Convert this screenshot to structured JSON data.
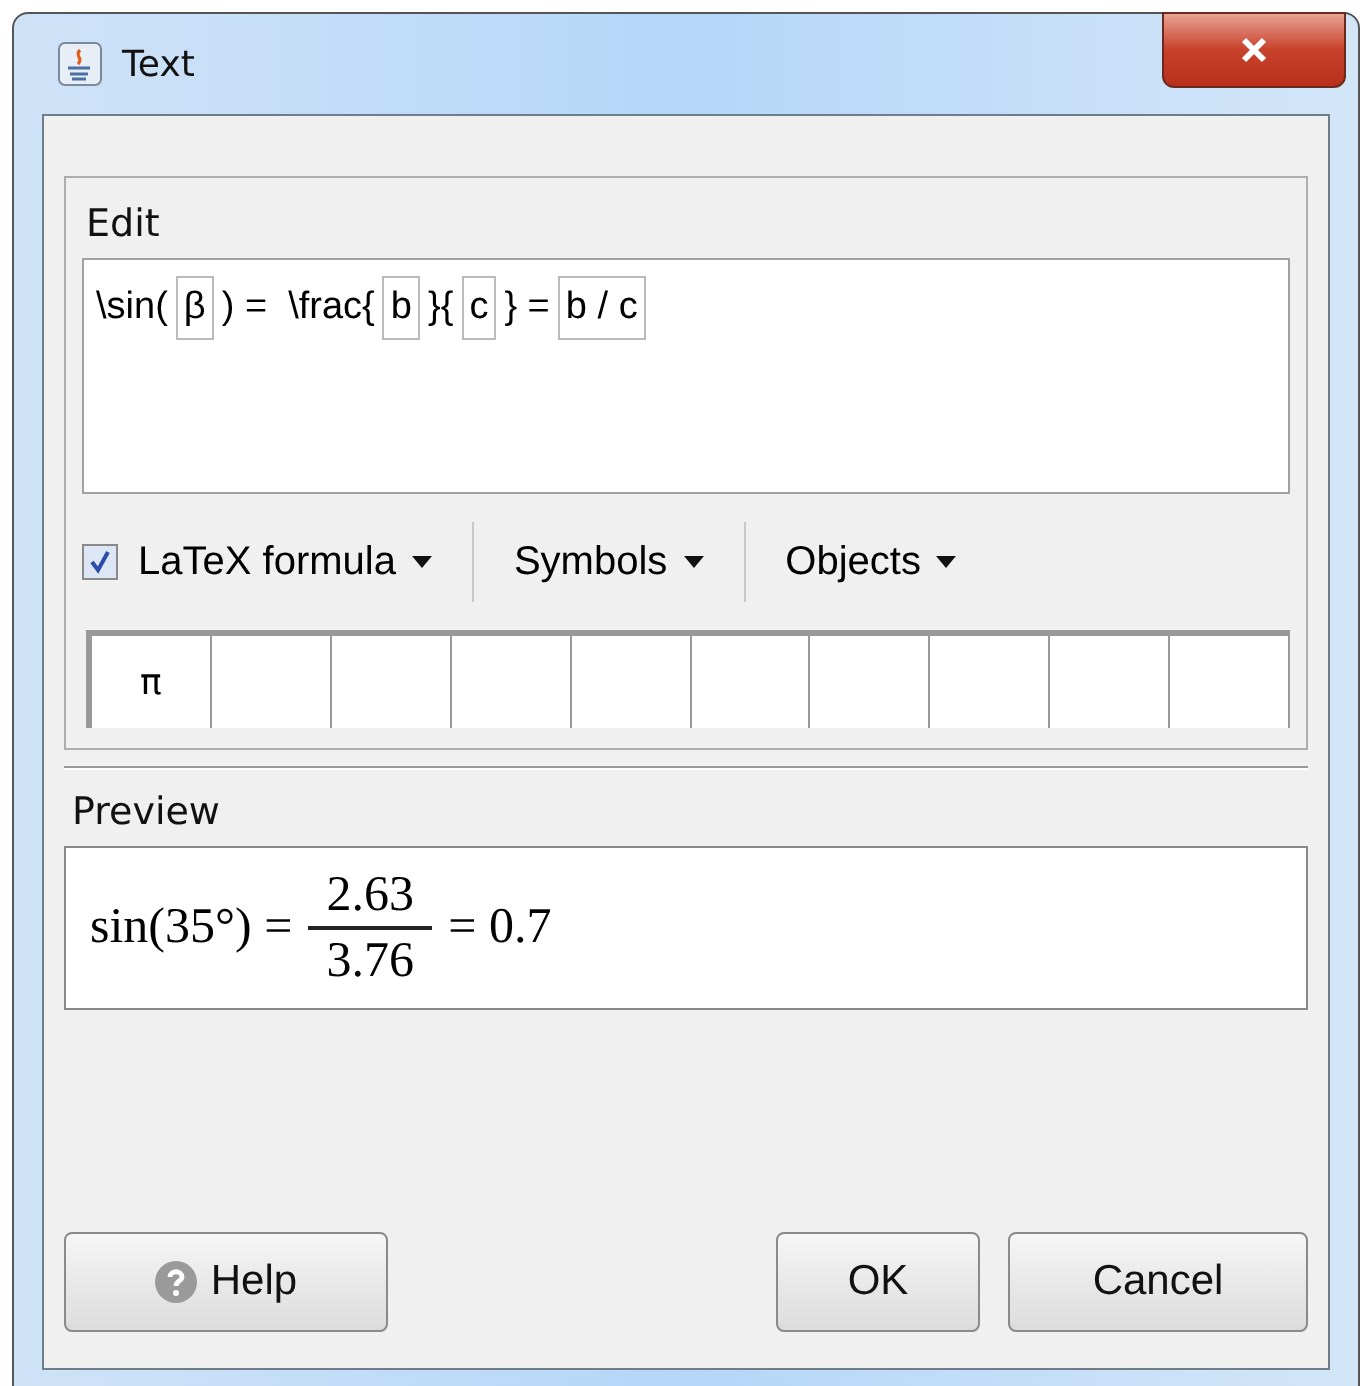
{
  "window": {
    "title": "Text"
  },
  "edit": {
    "label": "Edit",
    "segments": [
      {
        "kind": "text",
        "text": "\\sin("
      },
      {
        "kind": "box",
        "text": "β"
      },
      {
        "kind": "text",
        "text": ") =  \\frac{"
      },
      {
        "kind": "box",
        "text": "b"
      },
      {
        "kind": "text",
        "text": "}{"
      },
      {
        "kind": "box",
        "text": "c"
      },
      {
        "kind": "text",
        "text": "} ="
      },
      {
        "kind": "box",
        "text": "b / c"
      }
    ]
  },
  "toolbar": {
    "latex": {
      "label": "LaTeX formula",
      "checked": true
    },
    "menus": [
      "Symbols",
      "Objects"
    ]
  },
  "symbols": [
    "π"
  ],
  "preview": {
    "label": "Preview",
    "lhs": "sin(35°) =",
    "numerator": "2.63",
    "denominator": "3.76",
    "rhs": "= 0.7"
  },
  "buttons": {
    "help": "Help",
    "ok": "OK",
    "cancel": "Cancel"
  }
}
